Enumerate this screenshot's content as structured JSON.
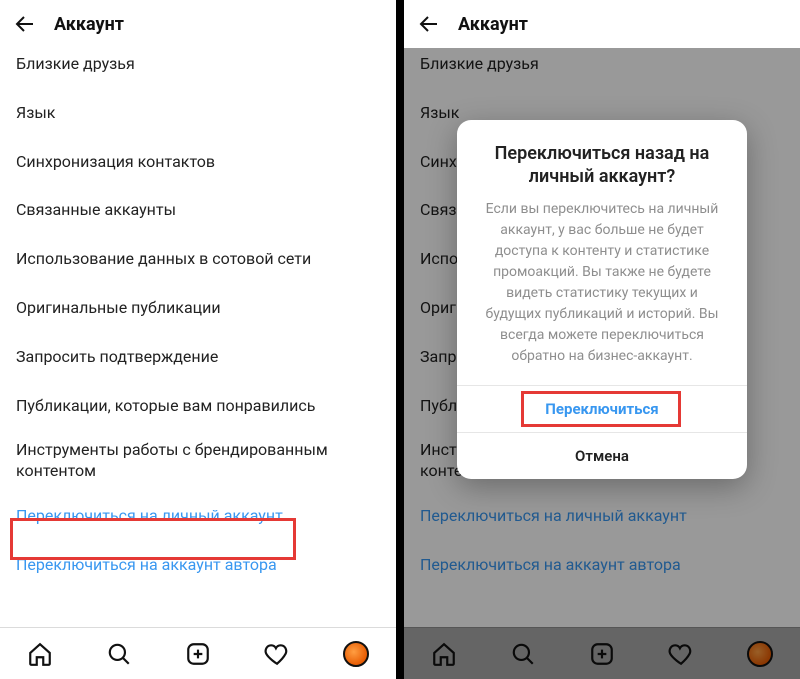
{
  "left": {
    "header": {
      "title": "Аккаунт"
    },
    "items": [
      "Близкие друзья",
      "Язык",
      "Синхронизация контактов",
      "Связанные аккаунты",
      "Использование данных в сотовой сети",
      "Оригинальные публикации",
      "Запросить подтверждение",
      "Публикации, которые вам понравились",
      "Инструменты работы с брендированным контентом"
    ],
    "link_items": [
      "Переключиться на личный аккаунт",
      "Переключиться на аккаунт автора"
    ]
  },
  "right": {
    "header": {
      "title": "Аккаунт"
    },
    "items": [
      "Близкие друзья",
      "Язык",
      "Синхронизация контактов",
      "Связанные аккаунты",
      "Использование данных в сотовой сети",
      "Оригинальные публикации",
      "Запросить подтверждение",
      "Публикации, которые вам понравились",
      "Инструменты работы с брендированным контентом"
    ],
    "link_items": [
      "Переключиться на личный аккаунт",
      "Переключиться на аккаунт автора"
    ],
    "dialog": {
      "title": "Переключиться назад на личный аккаунт?",
      "body": "Если вы переключитесь на личный аккаунт, у вас больше не будет доступа к контенту и статистике промоакций. Вы также не будете видеть статистику текущих и будущих публикаций и историй. Вы всегда можете переключиться обратно на бизнес-аккаунт.",
      "confirm": "Переключиться",
      "cancel": "Отмена"
    }
  }
}
